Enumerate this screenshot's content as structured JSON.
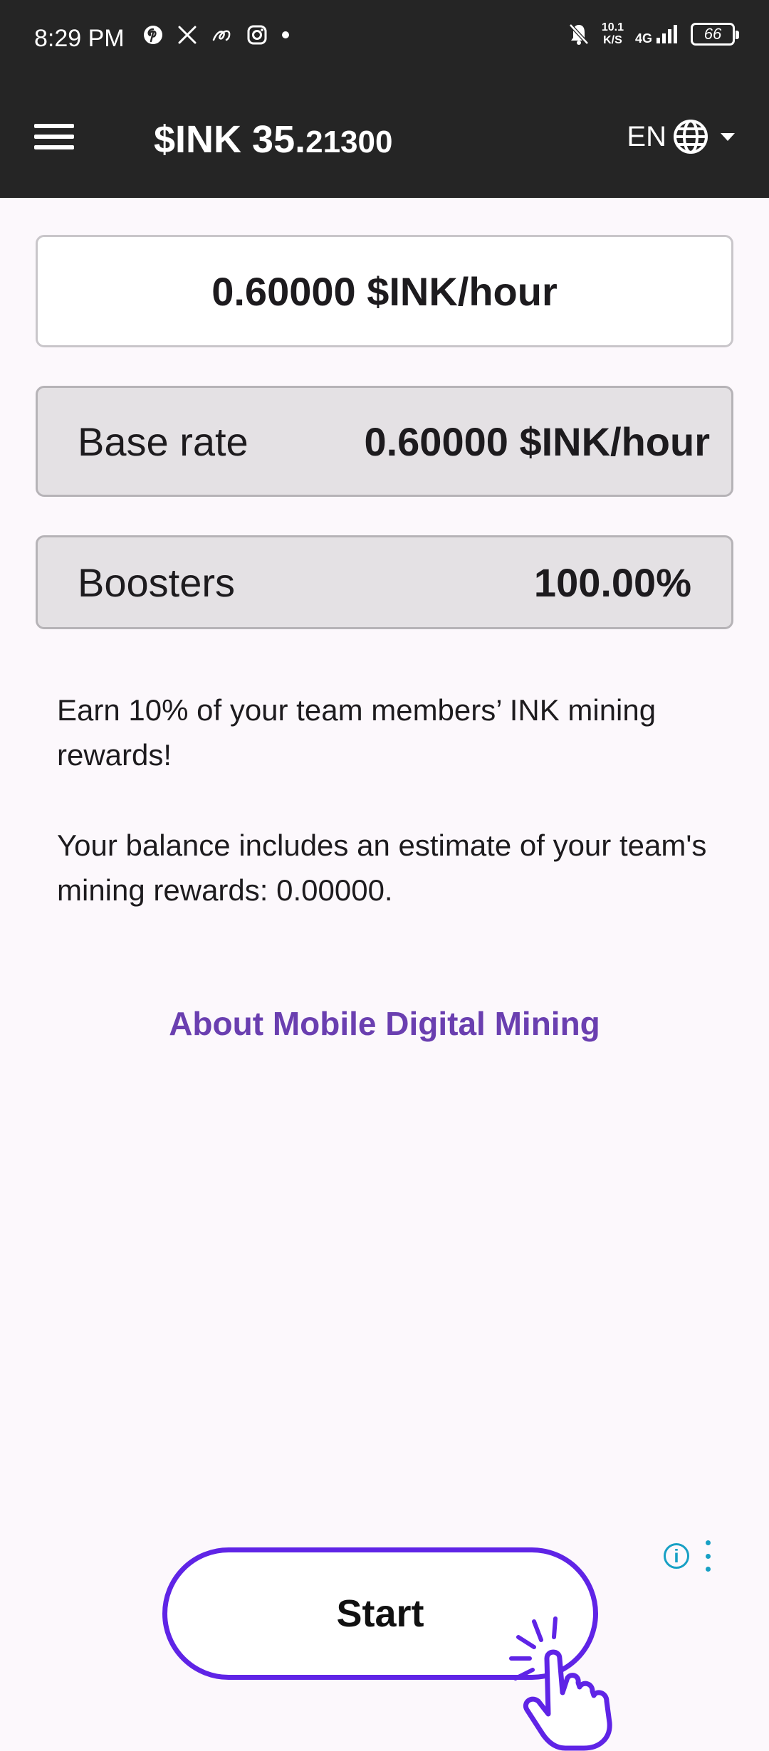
{
  "status_bar": {
    "time": "8:29 PM",
    "left_icons": [
      "pinterest-icon",
      "x-icon",
      "link-icon",
      "instagram-icon",
      "dot-icon"
    ],
    "net_speed_value": "10.1",
    "net_speed_unit": "K/S",
    "network": "4G",
    "battery": "66"
  },
  "app_bar": {
    "balance_main": "$INK 35.",
    "balance_decimals": "21300",
    "language": "EN"
  },
  "mining": {
    "rate": "0.60000 $INK/hour",
    "base_rate_label": "Base rate",
    "base_rate_value": "0.60000 $INK/hour",
    "boosters_label": "Boosters",
    "boosters_value": "100.00%",
    "team_note": "Earn 10% of your team members’ INK mining rewards!",
    "balance_note": "Your balance includes an estimate of your team's mining rewards: 0.00000.",
    "about_link": "About Mobile Digital Mining"
  },
  "ad": {
    "start_label": "Start"
  },
  "colors": {
    "top_bar": "#252525",
    "background": "#fcf8fc",
    "link": "#6a3fb0",
    "ad_button_border": "#5f24e6",
    "ad_icon": "#17a0c4"
  }
}
